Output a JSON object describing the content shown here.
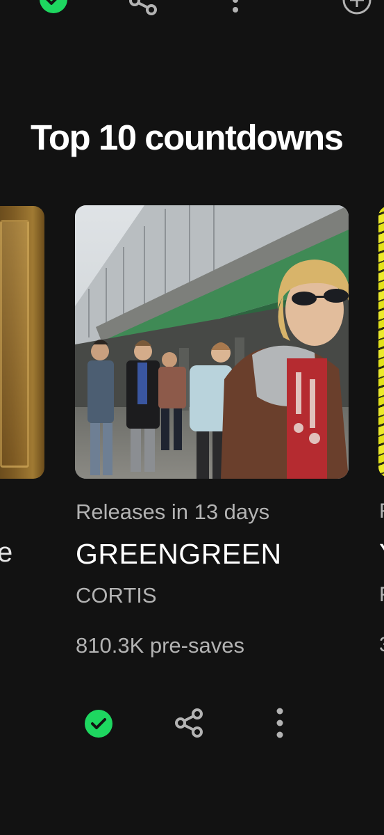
{
  "top_actions": {
    "saved_icon": "check-circle-icon",
    "share_icon": "share-icon",
    "more_icon": "more-vertical-icon",
    "add_icon": "add-circle-icon"
  },
  "section": {
    "title": "Top 10 countdowns"
  },
  "cards": {
    "left_partial": {
      "title_fragment": "e"
    },
    "main": {
      "release_info": "Releases in 13 days",
      "title": "GREENGREEN",
      "artist": "CORTIS",
      "presaves": "810.3K pre-saves",
      "actions": {
        "saved_icon": "check-circle-icon",
        "share_icon": "share-icon",
        "more_icon": "more-vertical-icon"
      }
    },
    "right_partial": {
      "release_fragment": "R",
      "title_fragment": "Y",
      "artist_fragment": "F",
      "presaves_fragment": "3"
    }
  },
  "colors": {
    "background": "#121212",
    "accent_green": "#1ED760",
    "text_primary": "#FFFFFF",
    "text_secondary": "#B3B3B3"
  }
}
